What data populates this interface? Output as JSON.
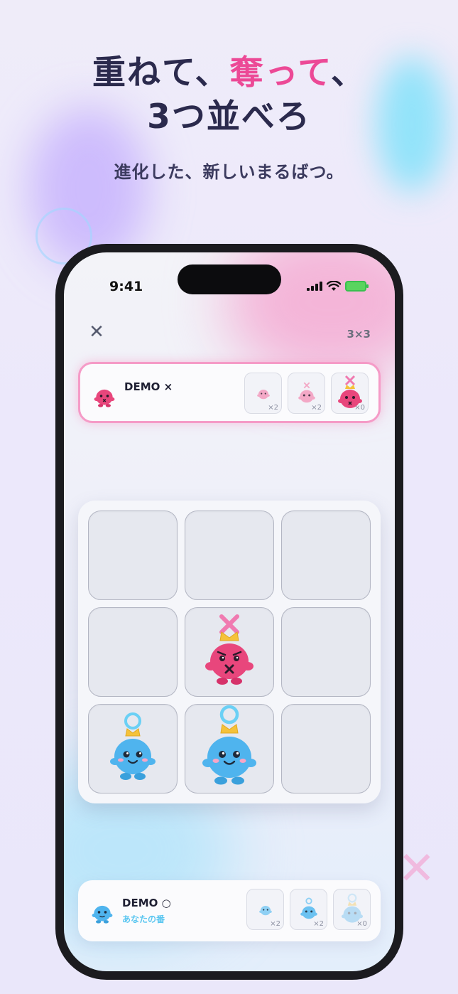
{
  "promo": {
    "headline_line1_a": "重ねて、",
    "headline_line1_b": "奪って",
    "headline_line1_c": "、",
    "headline_line2": "3つ並べろ",
    "subheadline": "進化した、新しいまるばつ。"
  },
  "status_bar": {
    "time": "9:41"
  },
  "header": {
    "close_icon": "close-icon",
    "grid_size": "3×3"
  },
  "opponent": {
    "name": "DEMO ×",
    "piece_color": "#e8467c",
    "pieces": [
      {
        "size": "small",
        "count": "×2"
      },
      {
        "size": "medium",
        "count": "×2"
      },
      {
        "size": "large",
        "count": "×0"
      }
    ]
  },
  "player": {
    "name": "DEMO ○",
    "status": "あなたの番",
    "piece_color": "#4fb4ee",
    "pieces": [
      {
        "size": "small",
        "count": "×2"
      },
      {
        "size": "medium",
        "count": "×2"
      },
      {
        "size": "large",
        "count": "×0"
      }
    ]
  },
  "board": {
    "cells": [
      {
        "row": 1,
        "col": 1,
        "piece": null
      },
      {
        "row": 1,
        "col": 2,
        "piece": null
      },
      {
        "row": 1,
        "col": 3,
        "piece": null
      },
      {
        "row": 2,
        "col": 1,
        "piece": null
      },
      {
        "row": 2,
        "col": 2,
        "piece": {
          "owner": "×",
          "size": "large"
        }
      },
      {
        "row": 2,
        "col": 3,
        "piece": null
      },
      {
        "row": 3,
        "col": 1,
        "piece": {
          "owner": "○",
          "size": "medium"
        }
      },
      {
        "row": 3,
        "col": 2,
        "piece": {
          "owner": "○",
          "size": "large"
        }
      },
      {
        "row": 3,
        "col": 3,
        "piece": null
      }
    ]
  }
}
